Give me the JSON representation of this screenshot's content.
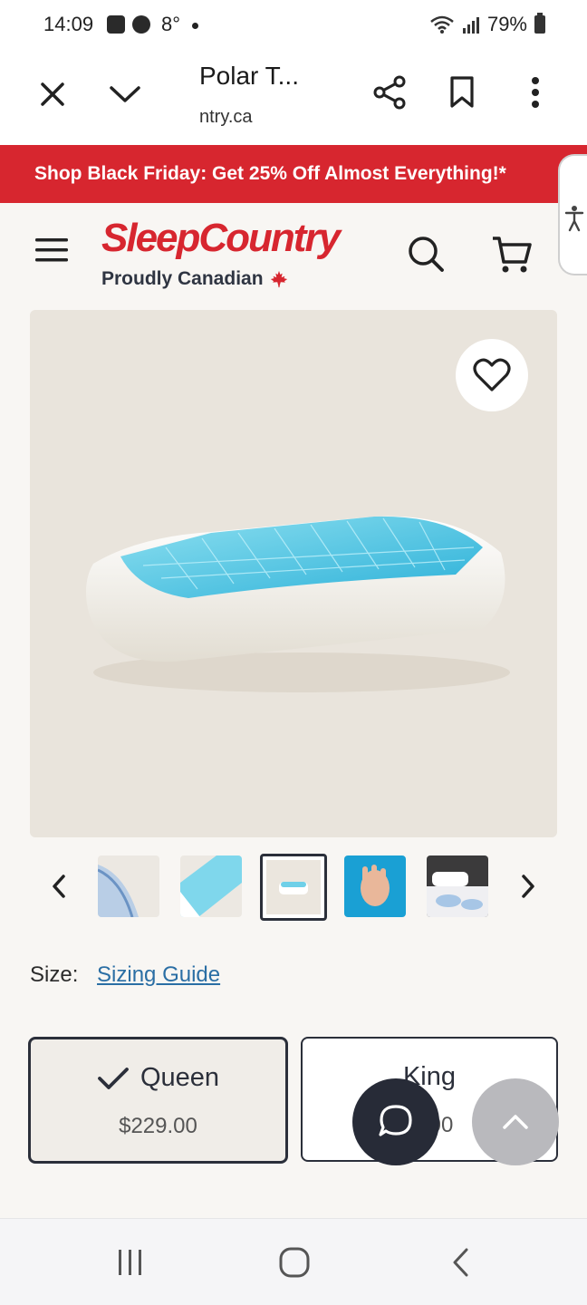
{
  "status_bar": {
    "time": "14:09",
    "temperature": "8°",
    "battery": "79%",
    "icons": [
      "gallery-icon",
      "messenger-icon",
      "wifi-icon",
      "signal-icon",
      "battery-icon"
    ]
  },
  "browser": {
    "title": "Polar T...",
    "url": "ntry.ca"
  },
  "promo": {
    "text": "Shop Black Friday: Get 25% Off Almost Everything!*"
  },
  "site": {
    "logo_main": "SleepCountry",
    "logo_sub": "Proudly Canadian"
  },
  "product": {
    "thumbnails_count": 5,
    "selected_thumbnail": 3
  },
  "size": {
    "label": "Size:",
    "guide_link": "Sizing Guide",
    "options": [
      {
        "name": "Queen",
        "price": "$229.00",
        "selected": true
      },
      {
        "name": "King",
        "price": "00",
        "selected": false
      }
    ]
  },
  "colors": {
    "brand_red": "#d7262f",
    "dark": "#2b2f3a",
    "link": "#2a6ea4"
  }
}
